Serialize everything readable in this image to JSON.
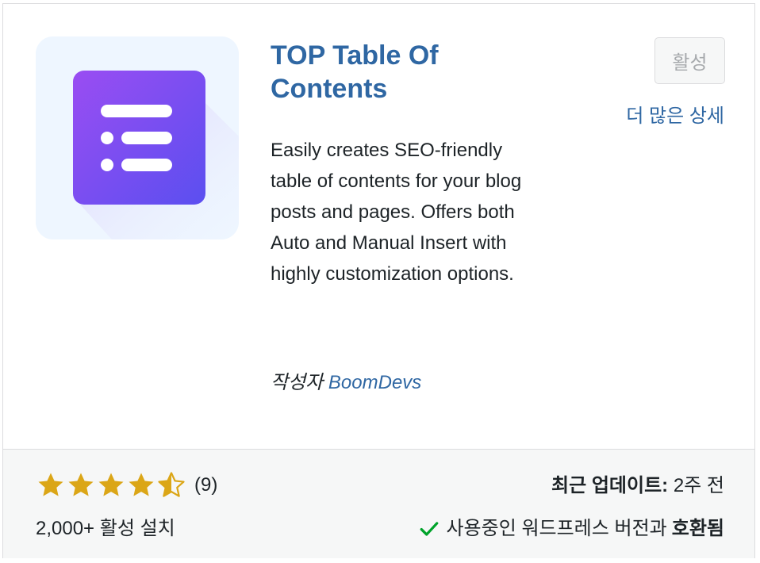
{
  "plugin": {
    "title": "TOP Table Of Contents",
    "description": "Easily creates SEO-friendly table of contents for your blog posts and pages. Offers both Auto and Manual Insert with highly customization options.",
    "author_prefix": "작성자",
    "author_name": "BoomDevs",
    "icon": "list-icon",
    "accent_color": "#7b4ff0"
  },
  "actions": {
    "activate_label": "활성",
    "more_details_label": "더 많은 상세"
  },
  "footer": {
    "rating_value": 4.5,
    "rating_max": 5,
    "rating_count": "(9)",
    "installs": "2,000+ 활성 설치",
    "last_updated_label": "최근 업데이트:",
    "last_updated_value": "2주 전",
    "compat_prefix": "사용중인 워드프레스 버전과",
    "compat_status": "호환됨",
    "star_color": "#dba617"
  }
}
